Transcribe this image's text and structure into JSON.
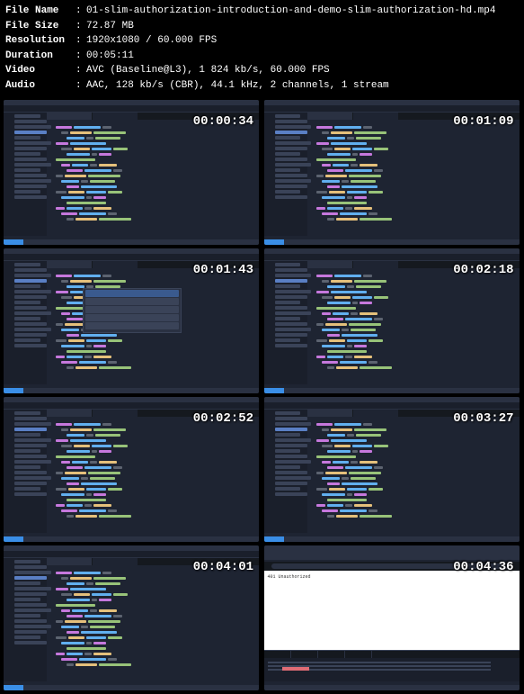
{
  "header": {
    "filename_label": "File Name",
    "filename_value": "01-slim-authorization-introduction-and-demo-slim-authorization-hd.mp4",
    "filesize_label": "File Size",
    "filesize_value": "72.87 MB",
    "resolution_label": "Resolution",
    "resolution_value": "1920x1080 / 60.000 FPS",
    "duration_label": "Duration",
    "duration_value": "00:05:11",
    "video_label": "Video",
    "video_value": "AVC (Baseline@L3), 1 824 kb/s, 60.000 FPS",
    "audio_label": "Audio",
    "audio_value": "AAC, 128 kb/s (CBR), 44.1 kHz, 2 channels, 1 stream",
    "separator": ":"
  },
  "thumbnails": [
    {
      "timestamp": "00:00:34",
      "type": "editor"
    },
    {
      "timestamp": "00:01:09",
      "type": "editor"
    },
    {
      "timestamp": "00:01:43",
      "type": "editor-autocomplete"
    },
    {
      "timestamp": "00:02:18",
      "type": "editor"
    },
    {
      "timestamp": "00:02:52",
      "type": "editor"
    },
    {
      "timestamp": "00:03:27",
      "type": "editor"
    },
    {
      "timestamp": "00:04:01",
      "type": "editor"
    },
    {
      "timestamp": "00:04:36",
      "type": "browser"
    }
  ],
  "browser": {
    "page_text": "401 Unauthorized"
  }
}
